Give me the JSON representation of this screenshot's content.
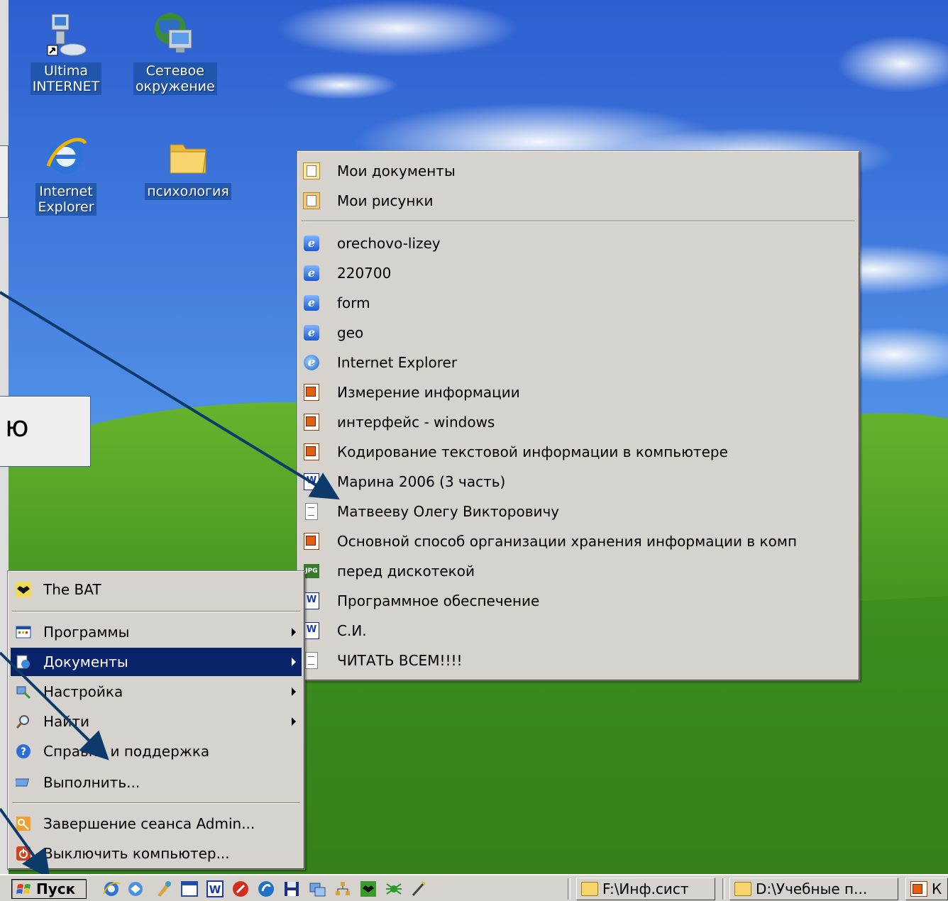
{
  "desktop": {
    "icons": [
      {
        "label_1": "Ultima",
        "label_2": "INTERNET"
      },
      {
        "label_1": "Сетевое",
        "label_2": "окружение"
      },
      {
        "label_1": "Internet",
        "label_2": "Explorer"
      },
      {
        "label_1": "психология",
        "label_2": ""
      }
    ],
    "callout_text": "ю"
  },
  "start_menu": {
    "items": [
      {
        "label": "The BAT",
        "icon": "bat-icon"
      },
      {
        "label": "Программы",
        "icon": "programs-icon",
        "submenu": true
      },
      {
        "label": "Документы",
        "icon": "documents-icon",
        "submenu": true,
        "highlighted": true
      },
      {
        "label": "Настройка",
        "icon": "settings-icon",
        "submenu": true
      },
      {
        "label": "Найти",
        "icon": "search-icon",
        "submenu": true
      },
      {
        "label": "Справка и поддержка",
        "icon": "help-icon"
      },
      {
        "label": "Выполнить...",
        "icon": "run-icon"
      },
      {
        "label": "Завершение сеанса Admin...",
        "icon": "logoff-icon"
      },
      {
        "label": "Выключить компьютер...",
        "icon": "shutdown-icon"
      }
    ]
  },
  "documents_menu": {
    "items": [
      {
        "label": "Мои документы",
        "type": "docs"
      },
      {
        "label": "Мои рисунки",
        "type": "pics"
      },
      {
        "label": "orechovo-lizey",
        "type": "ie"
      },
      {
        "label": "220700",
        "type": "ie"
      },
      {
        "label": "form",
        "type": "ie"
      },
      {
        "label": "geo",
        "type": "ie"
      },
      {
        "label": "Internet Explorer",
        "type": "ie2"
      },
      {
        "label": "Измерение  информации",
        "type": "ppt"
      },
      {
        "label": "интерфейс - windows",
        "type": "ppt"
      },
      {
        "label": "Кодирование текстовой информации в компьютере",
        "type": "ppt"
      },
      {
        "label": "Марина 2006 (3 часть)",
        "type": "word"
      },
      {
        "label": "Матвееву Олегу Викторовичу",
        "type": "txt"
      },
      {
        "label": "Основной  способ  организации  хранения  информации  в  комп",
        "type": "ppt"
      },
      {
        "label": "перед дискотекой",
        "type": "jpg"
      },
      {
        "label": "Программное обеспечение",
        "type": "word"
      },
      {
        "label": "С.И.",
        "type": "word"
      },
      {
        "label": "ЧИТАТЬ ВСЕМ!!!!",
        "type": "txt"
      }
    ]
  },
  "taskbar": {
    "start_label": "Пуск",
    "buttons": [
      {
        "label": "F:\\Инф.сист"
      },
      {
        "label": "D:\\Учебные п..."
      },
      {
        "label": "К"
      }
    ]
  },
  "colors": {
    "highlight": "#0a246a",
    "menu_bg": "#d6d3ce",
    "arrow": "#0b3a6b"
  }
}
